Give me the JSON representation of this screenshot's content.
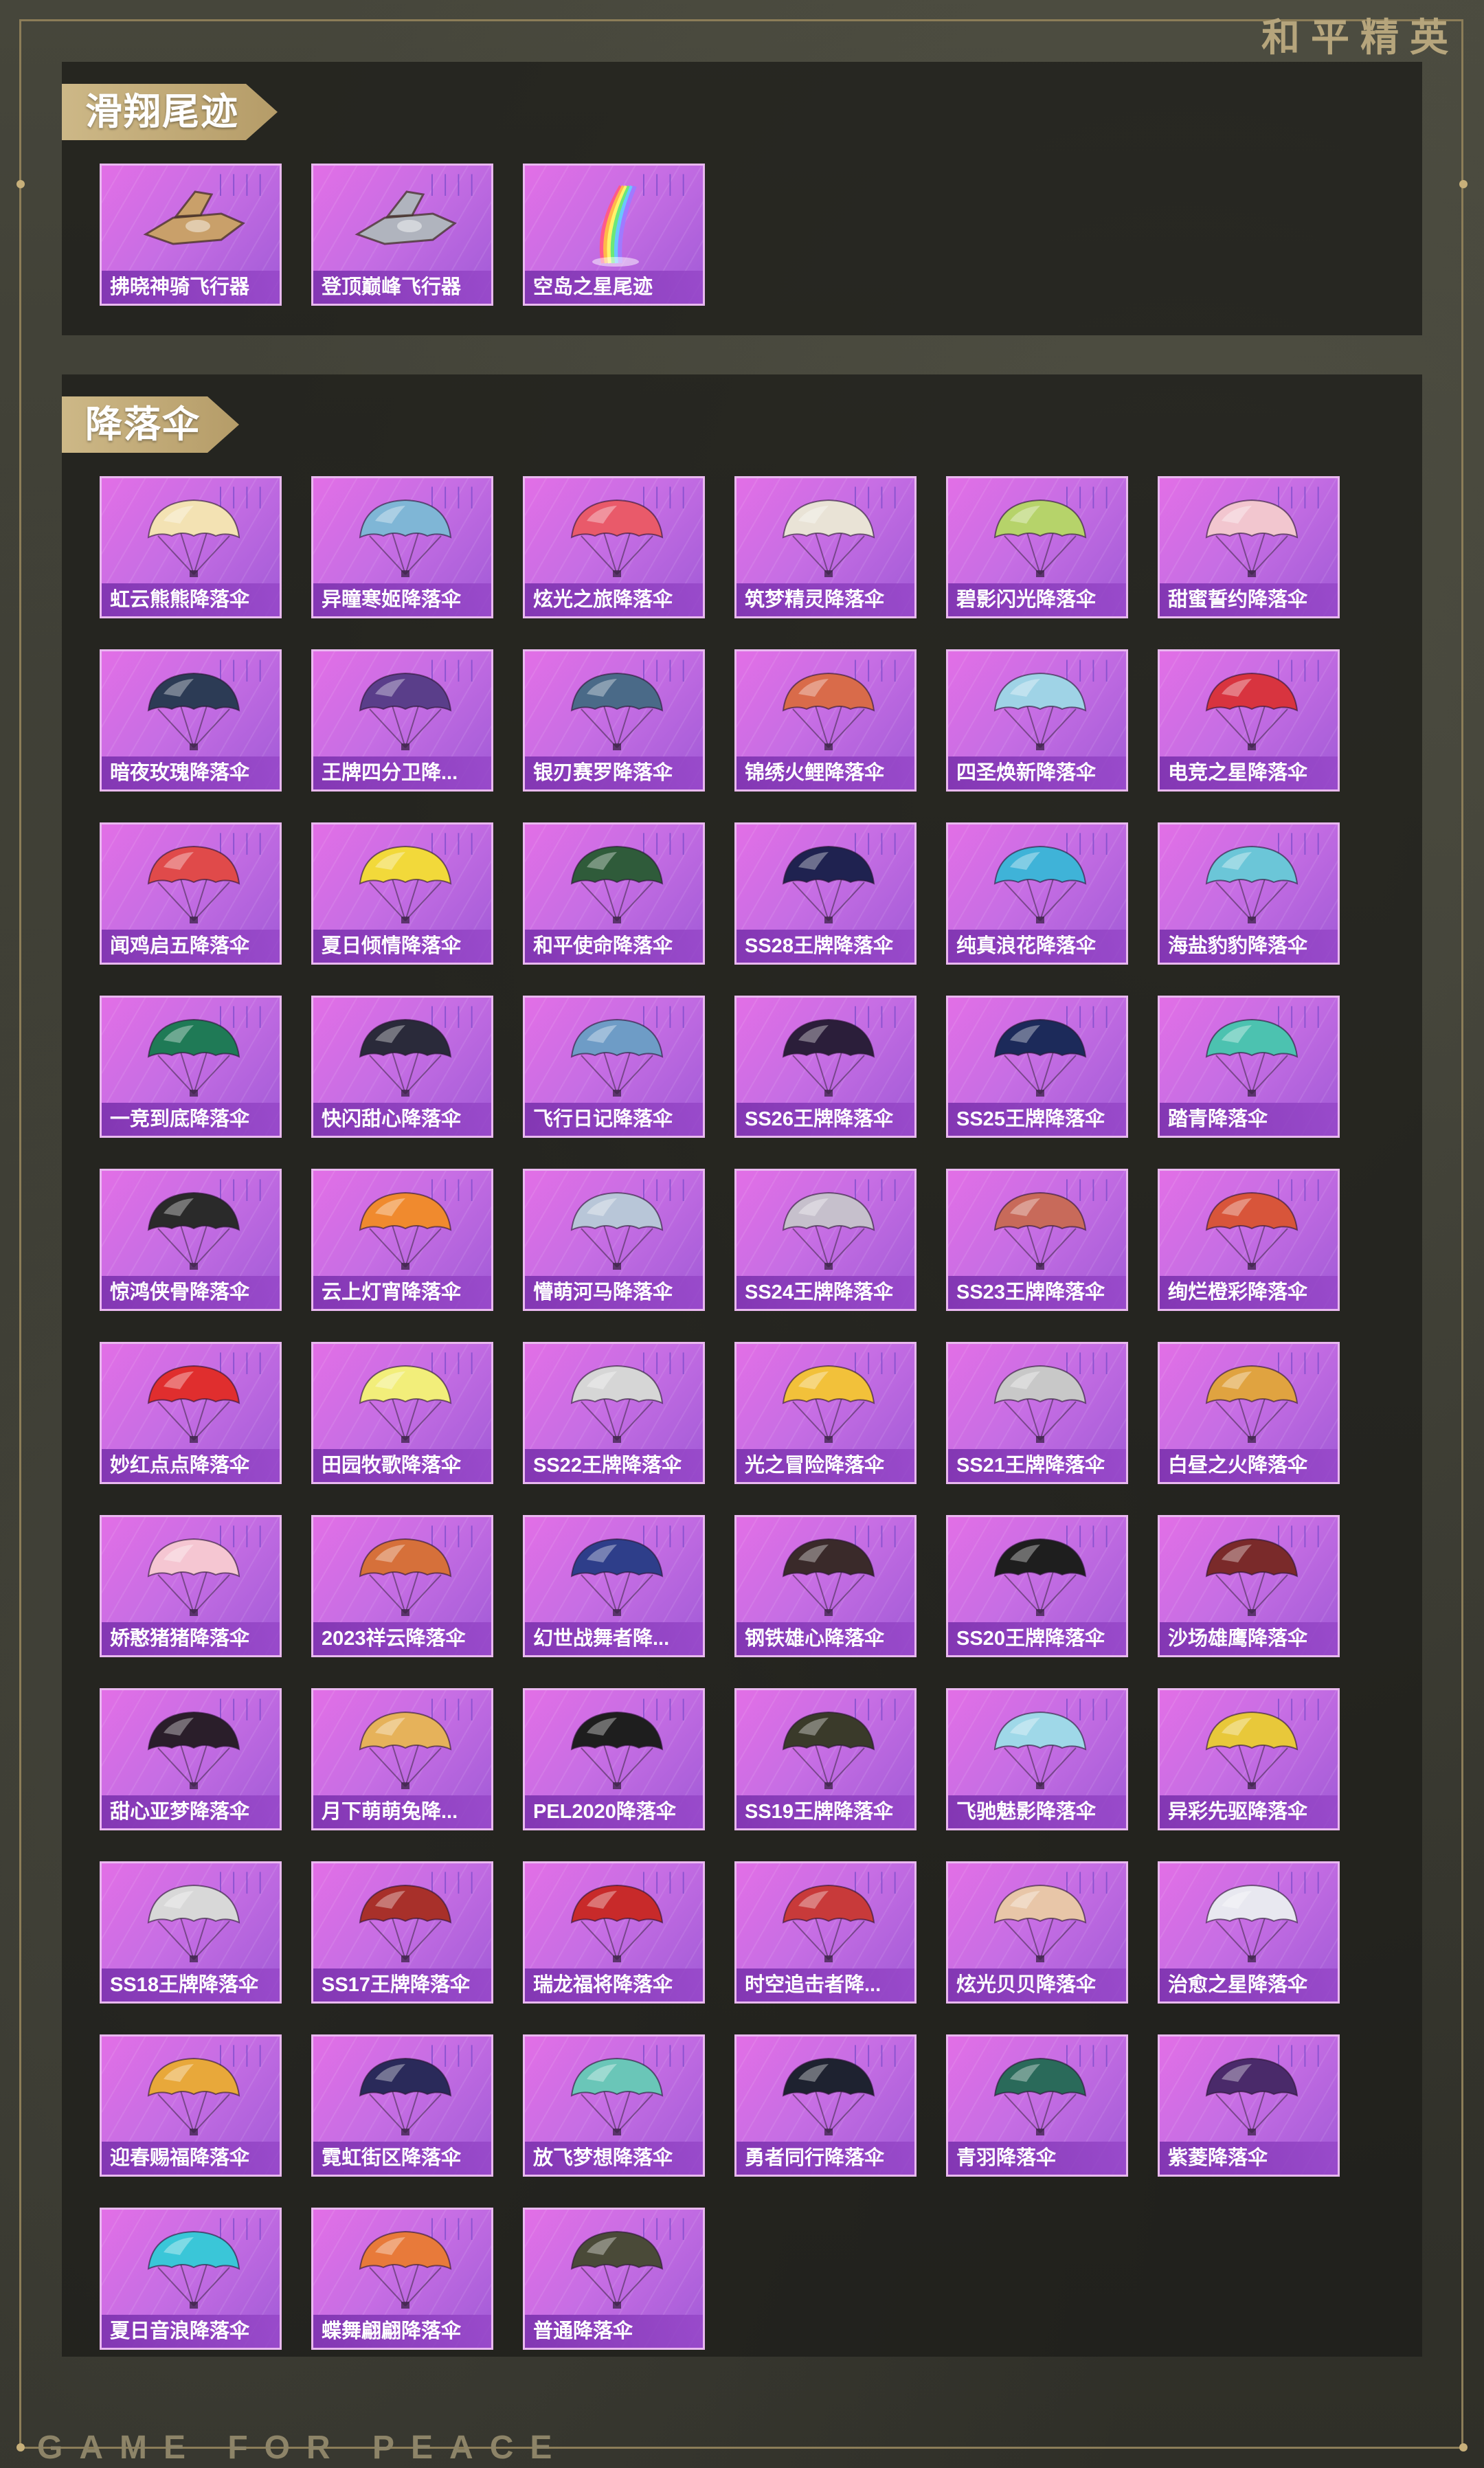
{
  "brand": {
    "logo_text": "和平精英",
    "footer_text": "GAME FOR PEACE"
  },
  "colors": {
    "card_gradient_start": "#e26fe6",
    "card_gradient_end": "#a05ad6",
    "section_tag": "#cdb887",
    "frame": "#8c7d58"
  },
  "sections": [
    {
      "title": "滑翔尾迹",
      "items": [
        {
          "name": "拂晓神骑飞行器",
          "icon": "glider-vehicle-icon",
          "color": "#c9a06a"
        },
        {
          "name": "登顶巅峰飞行器",
          "icon": "glider-vehicle-icon",
          "color": "#b0b4be"
        },
        {
          "name": "空岛之星尾迹",
          "icon": "rainbow-trail-icon",
          "color": "#8fd3ff"
        }
      ]
    },
    {
      "title": "降落伞",
      "items": [
        {
          "name": "虹云熊熊降落伞",
          "icon": "parachute-icon",
          "color": "#f3e2b3"
        },
        {
          "name": "异瞳寒姬降落伞",
          "icon": "parachute-icon",
          "color": "#7fb6d6"
        },
        {
          "name": "炫光之旅降落伞",
          "icon": "parachute-icon",
          "color": "#e95a6a"
        },
        {
          "name": "筑梦精灵降落伞",
          "icon": "parachute-icon",
          "color": "#e9e3d6"
        },
        {
          "name": "碧影闪光降落伞",
          "icon": "parachute-icon",
          "color": "#b6d36a"
        },
        {
          "name": "甜蜜誓约降落伞",
          "icon": "parachute-icon",
          "color": "#f2c6cf"
        },
        {
          "name": "暗夜玫瑰降落伞",
          "icon": "parachute-icon",
          "color": "#2c3b55"
        },
        {
          "name": "王牌四分卫降...",
          "icon": "parachute-icon",
          "color": "#5a3e8a"
        },
        {
          "name": "银刃赛罗降落伞",
          "icon": "parachute-icon",
          "color": "#4a6a88"
        },
        {
          "name": "锦绣火鲤降落伞",
          "icon": "parachute-icon",
          "color": "#d96b4a"
        },
        {
          "name": "四圣焕新降落伞",
          "icon": "parachute-icon",
          "color": "#9fd3e6"
        },
        {
          "name": "电竞之星降落伞",
          "icon": "parachute-icon",
          "color": "#d8343f"
        },
        {
          "name": "闻鸡启五降落伞",
          "icon": "parachute-icon",
          "color": "#e04a4a"
        },
        {
          "name": "夏日倾情降落伞",
          "icon": "parachute-icon",
          "color": "#f2d93a"
        },
        {
          "name": "和平使命降落伞",
          "icon": "parachute-icon",
          "color": "#2f5b3a"
        },
        {
          "name": "SS28王牌降落伞",
          "icon": "parachute-icon",
          "color": "#1f2250"
        },
        {
          "name": "纯真浪花降落伞",
          "icon": "parachute-icon",
          "color": "#3fb3d8"
        },
        {
          "name": "海盐豹豹降落伞",
          "icon": "parachute-icon",
          "color": "#6bc6d8"
        },
        {
          "name": "一竞到底降落伞",
          "icon": "parachute-icon",
          "color": "#1f7a56"
        },
        {
          "name": "快闪甜心降落伞",
          "icon": "parachute-icon",
          "color": "#2a2a3a"
        },
        {
          "name": "飞行日记降落伞",
          "icon": "parachute-icon",
          "color": "#6e9cc6"
        },
        {
          "name": "SS26王牌降落伞",
          "icon": "parachute-icon",
          "color": "#2b1e3a"
        },
        {
          "name": "SS25王牌降落伞",
          "icon": "parachute-icon",
          "color": "#1c2a5a"
        },
        {
          "name": "踏青降落伞",
          "icon": "parachute-icon",
          "color": "#4cc2b0"
        },
        {
          "name": "惊鸿侠骨降落伞",
          "icon": "parachute-icon",
          "color": "#2a2a2a"
        },
        {
          "name": "云上灯宵降落伞",
          "icon": "parachute-icon",
          "color": "#f08a2e"
        },
        {
          "name": "懵萌河马降落伞",
          "icon": "parachute-icon",
          "color": "#b8c6d8"
        },
        {
          "name": "SS24王牌降落伞",
          "icon": "parachute-icon",
          "color": "#c6c0cc"
        },
        {
          "name": "SS23王牌降落伞",
          "icon": "parachute-icon",
          "color": "#c86a5a"
        },
        {
          "name": "绚烂橙彩降落伞",
          "icon": "parachute-icon",
          "color": "#d8553a"
        },
        {
          "name": "妙红点点降落伞",
          "icon": "parachute-icon",
          "color": "#e02e2e"
        },
        {
          "name": "田园牧歌降落伞",
          "icon": "parachute-icon",
          "color": "#f2ee7a"
        },
        {
          "name": "SS22王牌降落伞",
          "icon": "parachute-icon",
          "color": "#d6d6d6"
        },
        {
          "name": "光之冒险降落伞",
          "icon": "parachute-icon",
          "color": "#f2c13a"
        },
        {
          "name": "SS21王牌降落伞",
          "icon": "parachute-icon",
          "color": "#c8c8c8"
        },
        {
          "name": "白昼之火降落伞",
          "icon": "parachute-icon",
          "color": "#e0a340"
        },
        {
          "name": "娇憨猪猪降落伞",
          "icon": "parachute-icon",
          "color": "#f5c6d2"
        },
        {
          "name": "2023祥云降落伞",
          "icon": "parachute-icon",
          "color": "#d6703a"
        },
        {
          "name": "幻世战舞者降...",
          "icon": "parachute-icon",
          "color": "#2e3e8a"
        },
        {
          "name": "钢铁雄心降落伞",
          "icon": "parachute-icon",
          "color": "#3a2a2a"
        },
        {
          "name": "SS20王牌降落伞",
          "icon": "parachute-icon",
          "color": "#1e1e1e"
        },
        {
          "name": "沙场雄鹰降落伞",
          "icon": "parachute-icon",
          "color": "#7a2a2a"
        },
        {
          "name": "甜心亚梦降落伞",
          "icon": "parachute-icon",
          "color": "#2a1e2a"
        },
        {
          "name": "月下萌萌兔降...",
          "icon": "parachute-icon",
          "color": "#e6b25a"
        },
        {
          "name": "PEL2020降落伞",
          "icon": "parachute-icon",
          "color": "#1e1e1e"
        },
        {
          "name": "SS19王牌降落伞",
          "icon": "parachute-icon",
          "color": "#3a3a2a"
        },
        {
          "name": "飞驰魅影降落伞",
          "icon": "parachute-icon",
          "color": "#9fd8e8"
        },
        {
          "name": "异彩先驱降落伞",
          "icon": "parachute-icon",
          "color": "#e8c83a"
        },
        {
          "name": "SS18王牌降落伞",
          "icon": "parachute-icon",
          "color": "#d8d8d8"
        },
        {
          "name": "SS17王牌降落伞",
          "icon": "parachute-icon",
          "color": "#a8302a"
        },
        {
          "name": "瑞龙福将降落伞",
          "icon": "parachute-icon",
          "color": "#c82a2a"
        },
        {
          "name": "时空追击者降...",
          "icon": "parachute-icon",
          "color": "#c83a3a"
        },
        {
          "name": "炫光贝贝降落伞",
          "icon": "parachute-icon",
          "color": "#e8c6a8"
        },
        {
          "name": "治愈之星降落伞",
          "icon": "parachute-icon",
          "color": "#e8e8f0"
        },
        {
          "name": "迎春赐福降落伞",
          "icon": "parachute-icon",
          "color": "#e8a83a"
        },
        {
          "name": "霓虹街区降落伞",
          "icon": "parachute-icon",
          "color": "#2a2a5a"
        },
        {
          "name": "放飞梦想降落伞",
          "icon": "parachute-icon",
          "color": "#6ac6b8"
        },
        {
          "name": "勇者同行降落伞",
          "icon": "parachute-icon",
          "color": "#1e2230"
        },
        {
          "name": "青羽降落伞",
          "icon": "parachute-icon",
          "color": "#2a6a5a"
        },
        {
          "name": "紫菱降落伞",
          "icon": "parachute-icon",
          "color": "#4a2a6a"
        },
        {
          "name": "夏日音浪降落伞",
          "icon": "parachute-icon",
          "color": "#3ac6d8"
        },
        {
          "name": "蝶舞翩翩降落伞",
          "icon": "parachute-icon",
          "color": "#e87a3a"
        },
        {
          "name": "普通降落伞",
          "icon": "parachute-icon",
          "color": "#4a4a38"
        }
      ]
    }
  ]
}
